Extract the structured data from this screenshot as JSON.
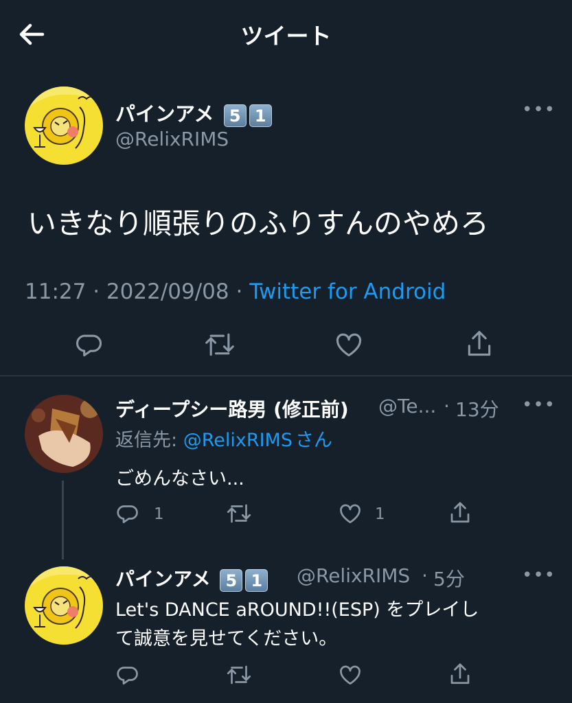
{
  "header": {
    "title": "ツイート",
    "back_icon": "arrow-left-icon"
  },
  "main_tweet": {
    "name": "パインアメ",
    "badges": [
      "5",
      "1"
    ],
    "handle": "@RelixRIMS",
    "text": "いきなり順張りのふりすんのやめろ",
    "time": "11:27",
    "separator": "·",
    "date": "2022/09/08",
    "source": "Twitter for Android",
    "actions": [
      "reply-icon",
      "retweet-icon",
      "like-icon",
      "share-icon"
    ]
  },
  "replies": [
    {
      "name": "ディープシー路男 (修正前)",
      "handle": "@Te...",
      "time": "13分",
      "reply_to_label": "返信先: ",
      "reply_to_handle": "@RelixRIMS",
      "reply_to_suffix": "さん",
      "text": "ごめんなさい...",
      "reply_count": "1",
      "like_count": "1"
    },
    {
      "name": "パインアメ",
      "badges": [
        "5",
        "1"
      ],
      "handle": "@RelixRIMS",
      "time": "5分",
      "text_line1": "Let's DANCE aROUND!!(ESP) をプレイし",
      "text_line2": "て誠意を見せてください。"
    }
  ],
  "colors": {
    "background": "#15202b",
    "secondary": "#8b98a5",
    "link": "#1d9bf0",
    "divider": "#38444d"
  }
}
